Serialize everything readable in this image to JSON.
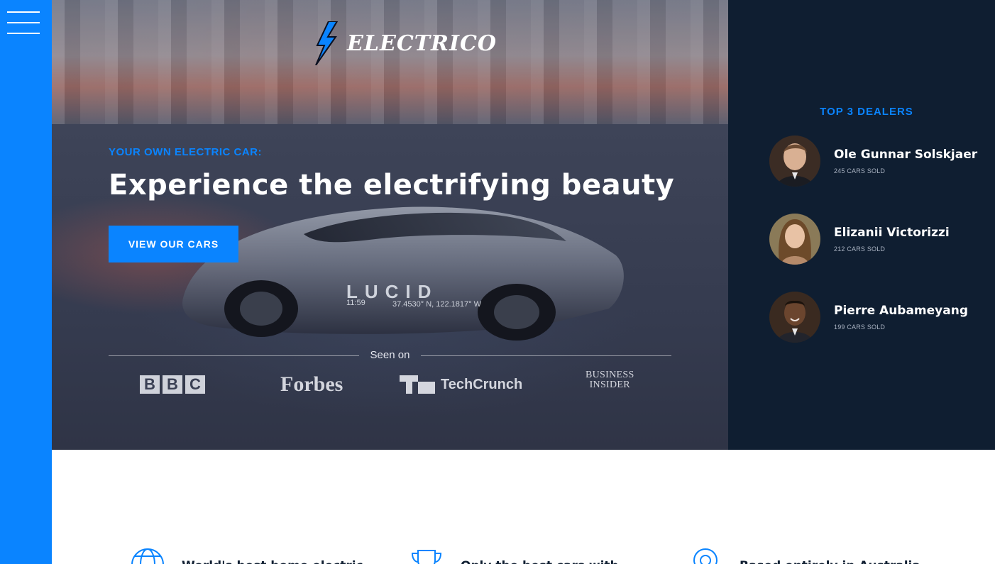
{
  "brand": {
    "name": "ELECTRICO"
  },
  "hero": {
    "eyebrow": "YOUR OWN ELECTRIC CAR:",
    "headline": "Experience the electrifying beauty",
    "cta_label": "VIEW OUR CARS",
    "car_plate": "LUCID",
    "car_text_1": "11:59",
    "car_text_2": "37.4530° N, 122.1817° W"
  },
  "press": {
    "label": "Seen on",
    "logos": [
      "BBC",
      "Forbes",
      "TechCrunch",
      "BUSINESS INSIDER"
    ],
    "bbc_letters": [
      "B",
      "B",
      "C"
    ],
    "techcrunch_word": "TechCrunch",
    "bi_line1": "BUSINESS",
    "bi_line2": "INSIDER"
  },
  "dealers": {
    "title": "TOP 3 DEALERS",
    "items": [
      {
        "name": "Ole Gunnar Solskjaer",
        "sold": "245 CARS SOLD"
      },
      {
        "name": "Elizanii Victorizzi",
        "sold": "212 CARS SOLD"
      },
      {
        "name": "Pierre Aubameyang",
        "sold": "199 CARS SOLD"
      }
    ]
  },
  "features": [
    {
      "icon": "globe-icon",
      "text": "World's best home electric"
    },
    {
      "icon": "trophy-icon",
      "text": "Only the best cars with"
    },
    {
      "icon": "location-pin-icon",
      "text": "Based entirely in Australia"
    }
  ],
  "colors": {
    "accent": "#0a84ff",
    "panel": "#0f1e31",
    "white": "#ffffff"
  }
}
